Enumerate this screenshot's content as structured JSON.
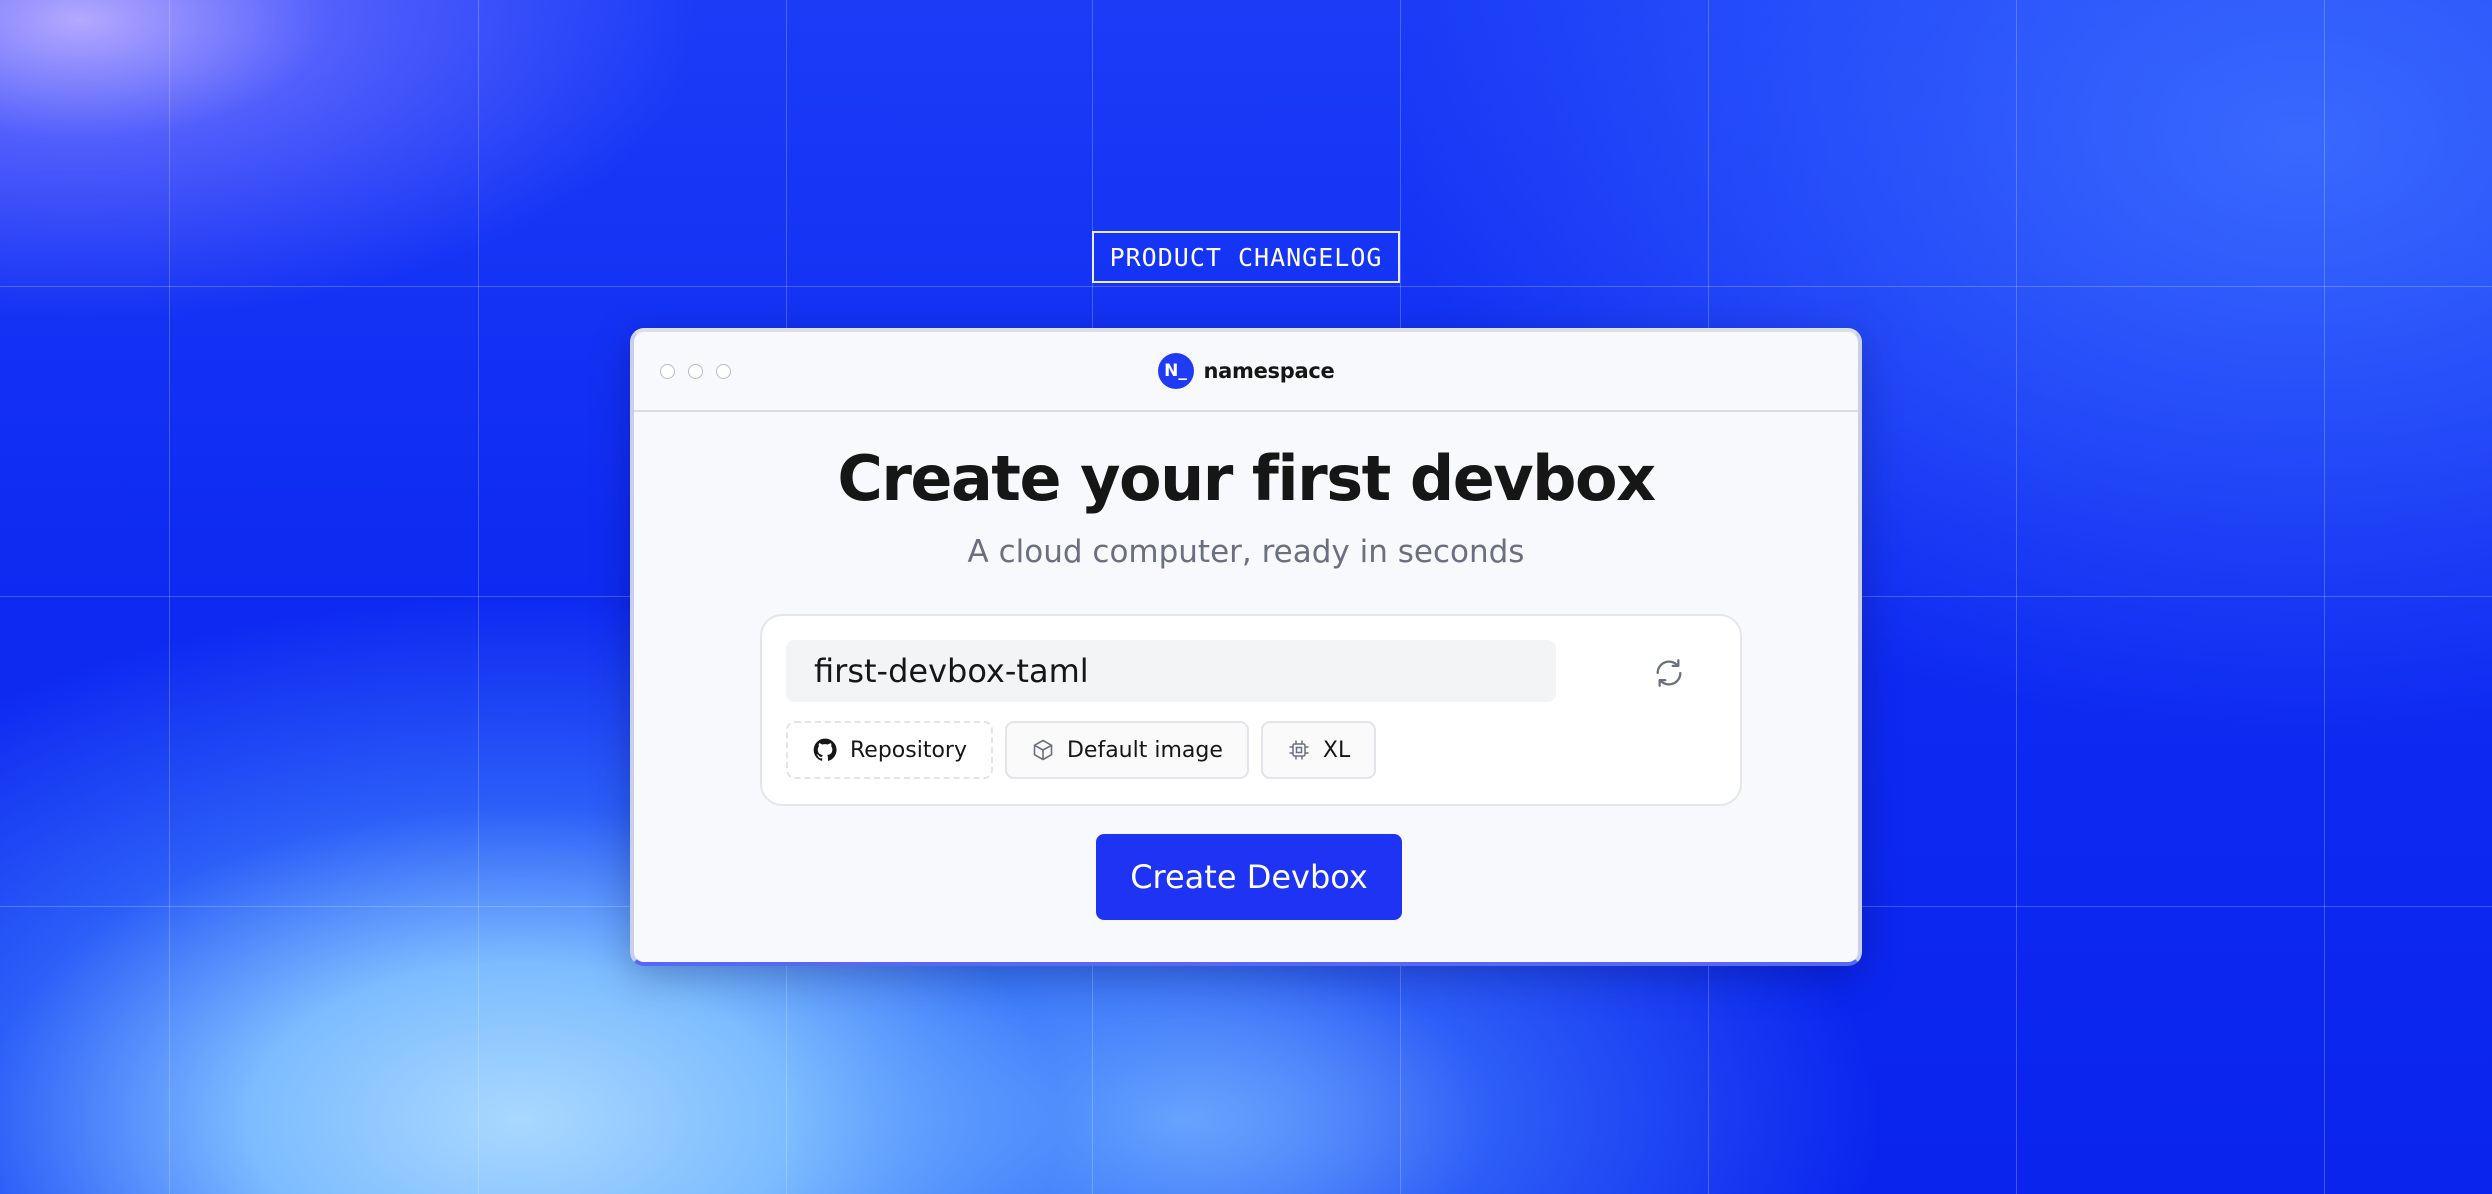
{
  "tag": {
    "label": "PRODUCT CHANGELOG"
  },
  "window": {
    "brand": {
      "logo_text": "N_",
      "name": "namespace"
    }
  },
  "hero": {
    "title": "Create your first devbox",
    "subtitle": "A cloud computer, ready in seconds"
  },
  "form": {
    "devbox_name": {
      "value": "first-devbox-taml"
    },
    "refresh_icon": "refresh-icon",
    "options": [
      {
        "label": "Repository",
        "icon": "github-icon"
      },
      {
        "label": "Default image",
        "icon": "cube-icon"
      },
      {
        "label": "XL",
        "icon": "cpu-chip-icon"
      }
    ]
  },
  "actions": {
    "create_label": "Create Devbox"
  },
  "colors": {
    "accent": "#1f33f5",
    "background": "#0f2bf2",
    "window_border": "#5867f6"
  }
}
